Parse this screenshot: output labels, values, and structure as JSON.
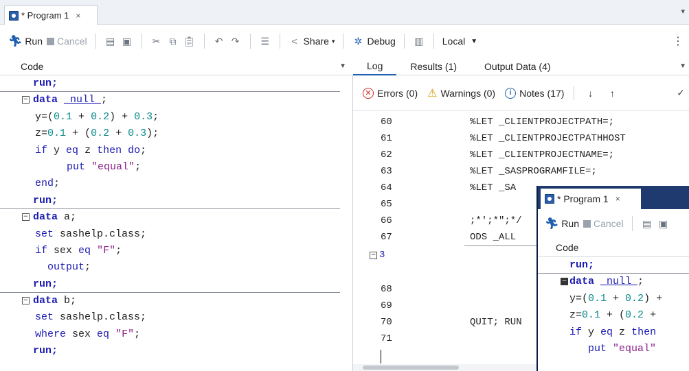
{
  "tab": {
    "title": "* Program 1",
    "close": "×"
  },
  "toolbar": {
    "run": "Run",
    "cancel": "Cancel",
    "share": "Share",
    "debug": "Debug",
    "local": "Local"
  },
  "code_panel": {
    "title": "Code"
  },
  "log_panel": {
    "tabs": [
      "Log",
      "Results (1)",
      "Output Data (4)"
    ],
    "errors": "Errors (0)",
    "warnings": "Warnings (0)",
    "notes": "Notes (17)"
  },
  "log_lines": [
    {
      "num": "60",
      "text": "%LET _CLIENTPROJECTPATH=;"
    },
    {
      "num": "61",
      "text": "%LET _CLIENTPROJECTPATHHOST"
    },
    {
      "num": "62",
      "text": "%LET _CLIENTPROJECTNAME=;"
    },
    {
      "num": "63",
      "text": "%LET _SASPROGRAMFILE=;"
    },
    {
      "num": "64",
      "text": "%LET _SA"
    },
    {
      "num": "65",
      "text": ""
    },
    {
      "num": "66",
      "text": ";*';*\";*/"
    },
    {
      "num": "67",
      "text": "ODS _ALL"
    },
    {
      "num": "3",
      "text": ""
    },
    {
      "num": "68",
      "text": ""
    },
    {
      "num": "69",
      "text": ""
    },
    {
      "num": "70",
      "text": "QUIT; RUN"
    },
    {
      "num": "71",
      "text": ""
    }
  ],
  "overlay": {
    "tab_title": "* Program 1",
    "close": "×",
    "run": "Run",
    "cancel": "Cancel",
    "code_title": "Code"
  }
}
